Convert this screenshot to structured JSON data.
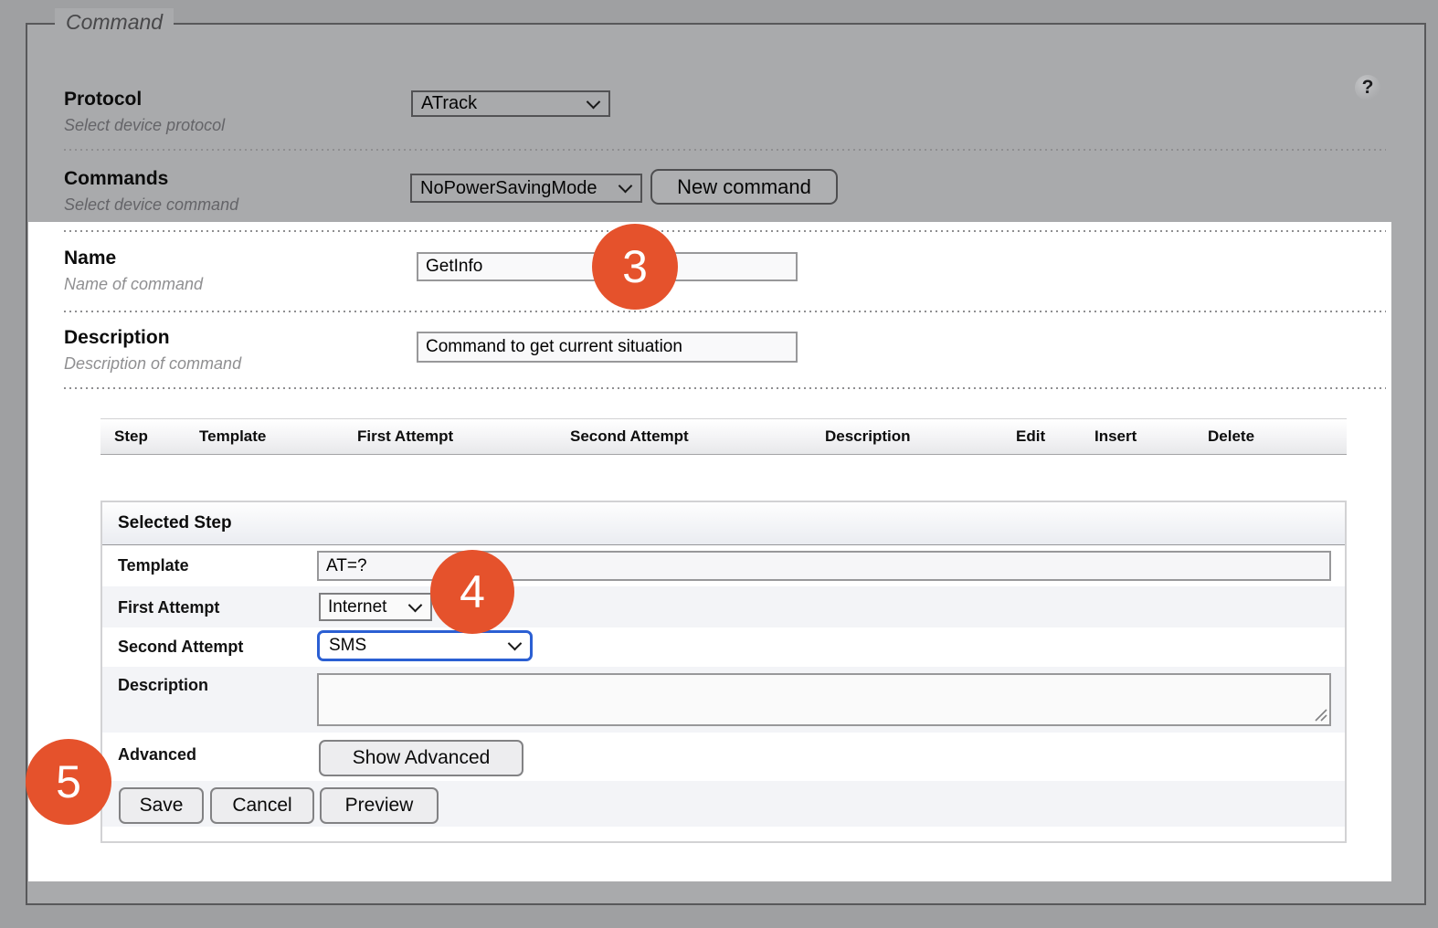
{
  "fieldset": {
    "legend": "Command"
  },
  "help_icon": {
    "glyph": "?"
  },
  "protocol": {
    "label": "Protocol",
    "hint": "Select device protocol",
    "value": "ATrack"
  },
  "commands": {
    "label": "Commands",
    "hint": "Select device command",
    "value": "NoPowerSavingMode",
    "new_command_label": "New command"
  },
  "name_field": {
    "label": "Name",
    "hint": "Name of command",
    "value": "GetInfo"
  },
  "description_field": {
    "label": "Description",
    "hint": "Description of command",
    "value": "Command to get current situation"
  },
  "steps_table": {
    "headers": [
      "Step",
      "Template",
      "First Attempt",
      "Second Attempt",
      "Description",
      "Edit",
      "Insert",
      "Delete"
    ]
  },
  "selected_step": {
    "title": "Selected Step",
    "template": {
      "label": "Template",
      "value": "AT=?"
    },
    "first_attempt": {
      "label": "First Attempt",
      "value": "Internet"
    },
    "second_attempt": {
      "label": "Second Attempt",
      "value": "SMS"
    },
    "description": {
      "label": "Description",
      "value": ""
    },
    "advanced": {
      "label": "Advanced",
      "button_label": "Show Advanced"
    },
    "actions": {
      "save": "Save",
      "cancel": "Cancel",
      "preview": "Preview"
    }
  },
  "annotations": {
    "badge3": "3",
    "badge4": "4",
    "badge5": "5"
  },
  "colors": {
    "accent-orange": "#E5522C",
    "focus-blue": "#2B5FD3",
    "page-bg": "#9FA0A2",
    "fieldset-bg": "#A9AAAC",
    "row-alt-bg": "#F3F4F7",
    "border-dark": "#58585A"
  }
}
